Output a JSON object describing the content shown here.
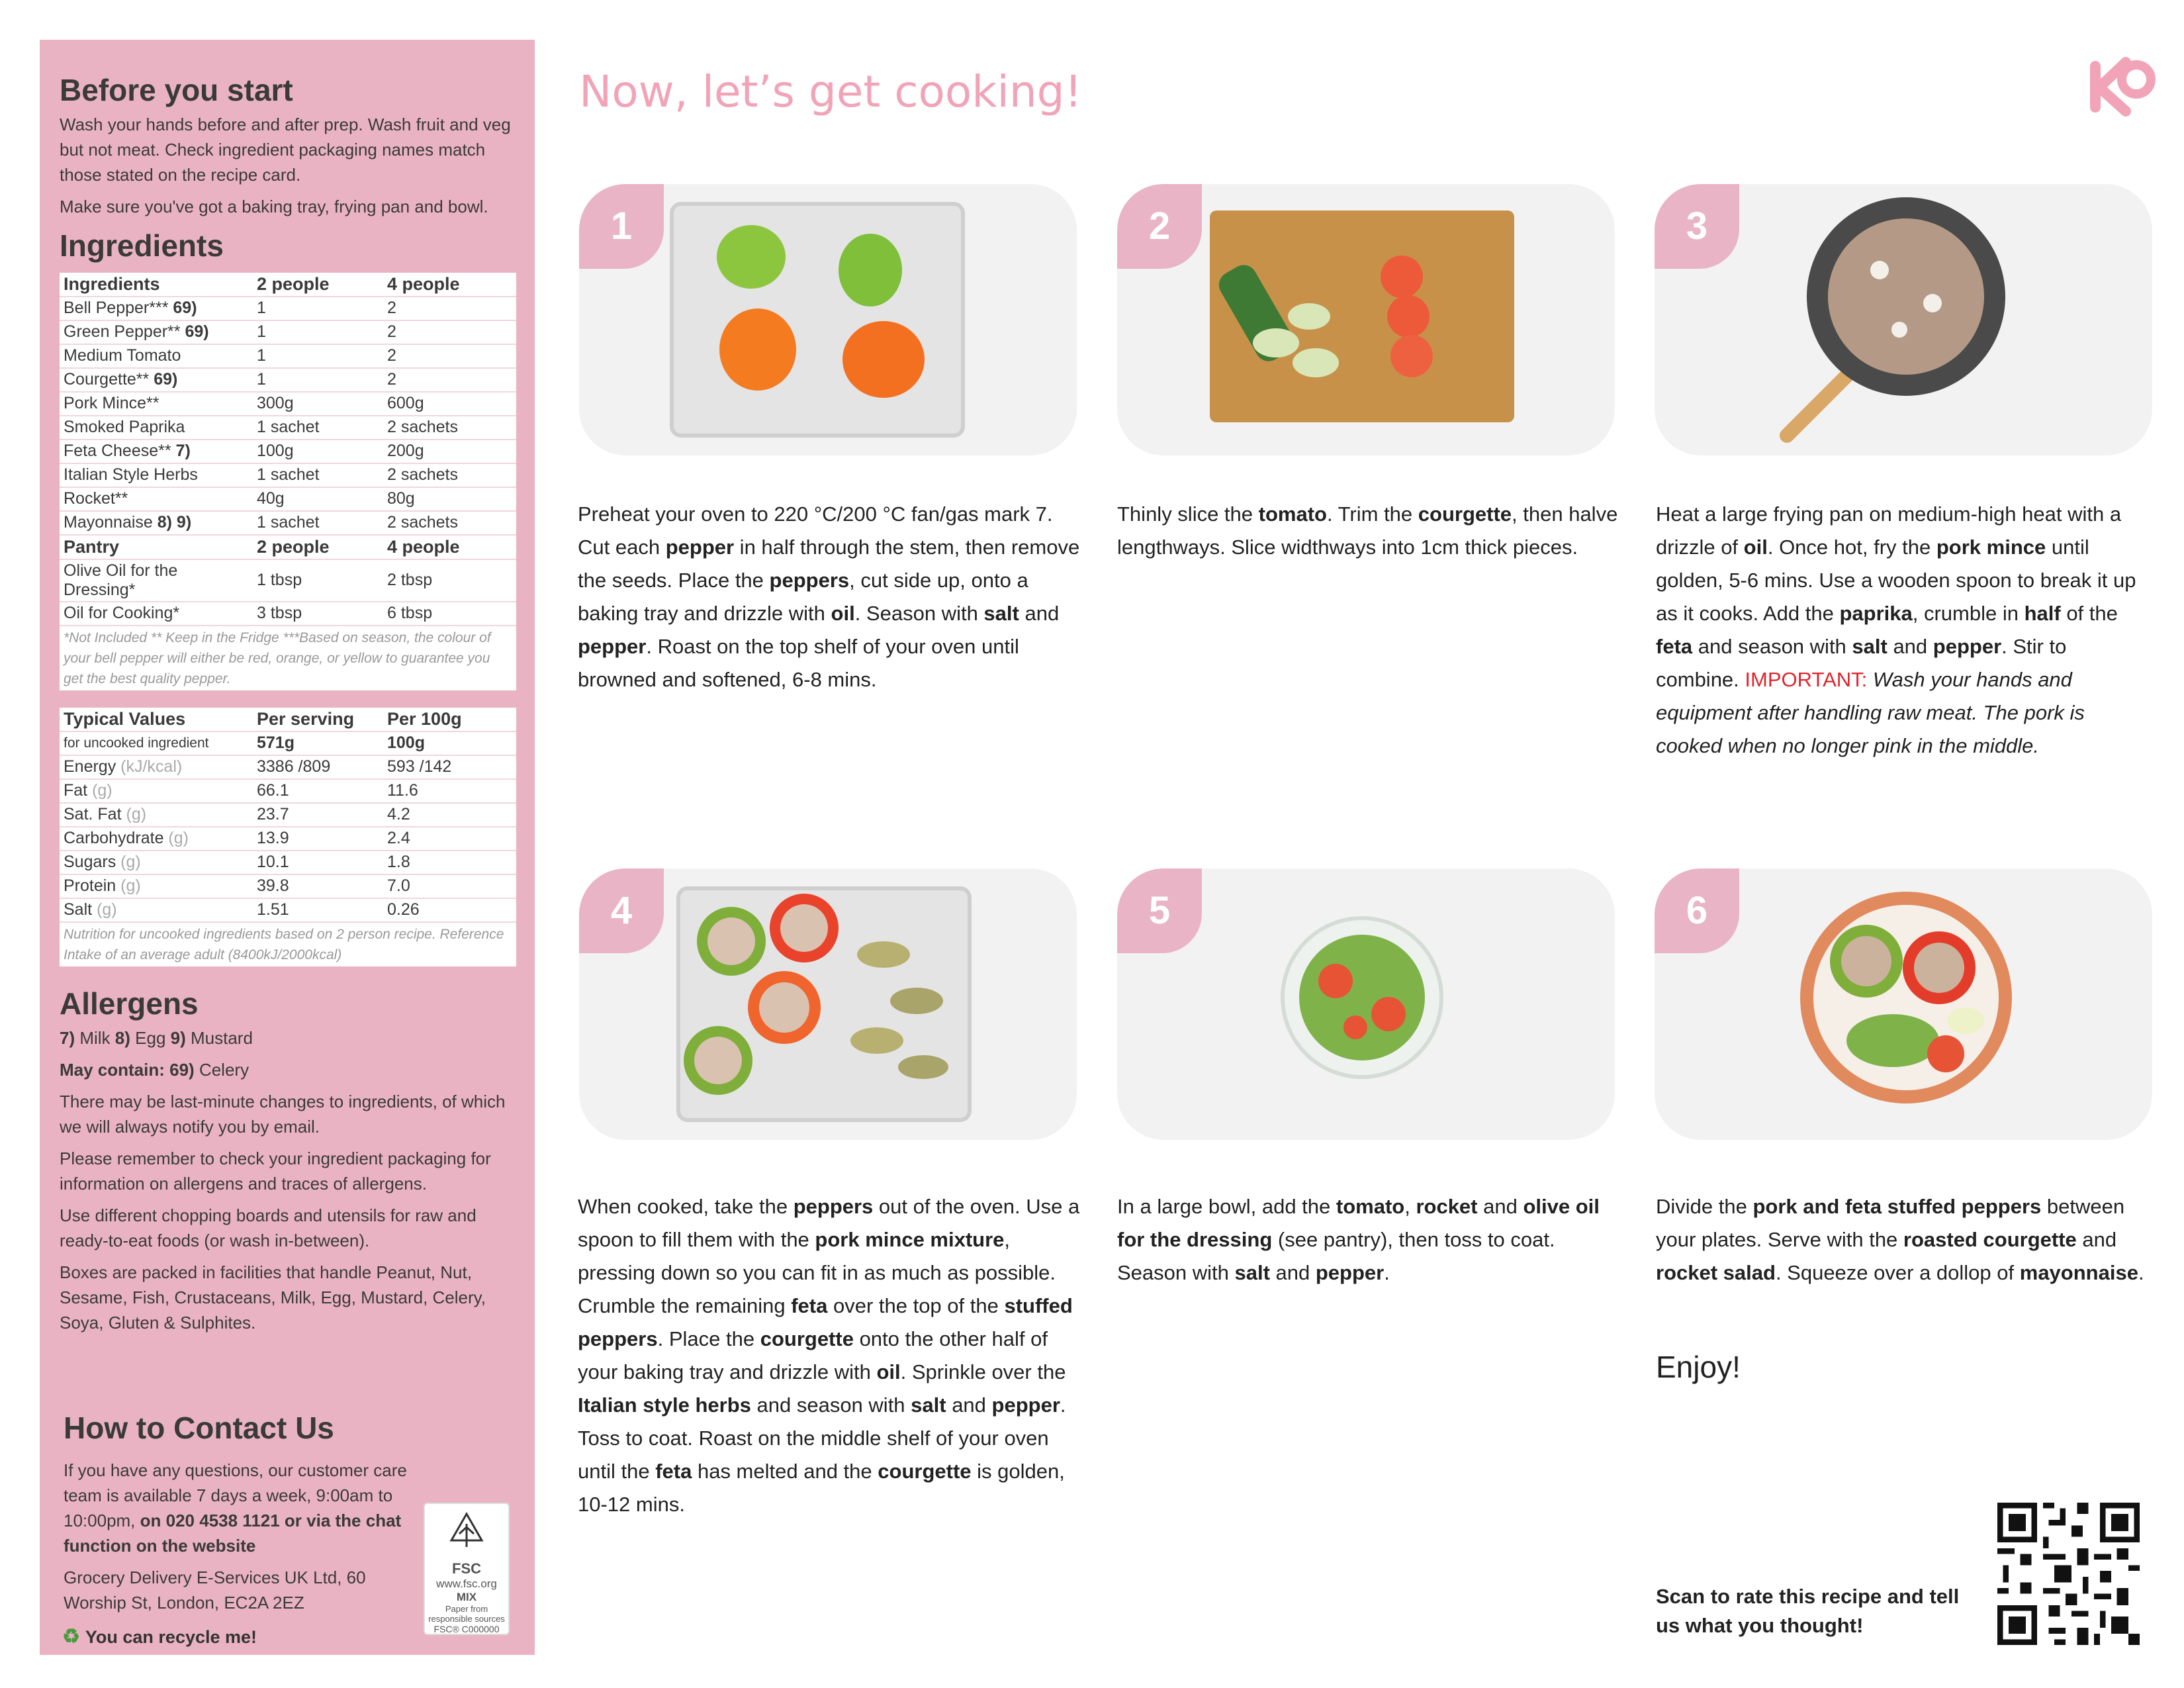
{
  "sidebar": {
    "before_title": "Before you start",
    "before_p1": "Wash your hands before and after prep. Wash fruit and veg but not meat. Check ingredient packaging names match those stated on the recipe card.",
    "before_p2": "Make sure you've got a baking tray, frying pan and bowl.",
    "ingredients_title": "Ingredients",
    "ingredients_header": [
      "Ingredients",
      "2 people",
      "4 people"
    ],
    "ingredients": [
      {
        "name": "Bell Pepper***",
        "code": " 69)",
        "p2": "1",
        "p4": "2"
      },
      {
        "name": "Green Pepper**",
        "code": " 69)",
        "p2": "1",
        "p4": "2"
      },
      {
        "name": "Medium Tomato",
        "code": "",
        "p2": "1",
        "p4": "2"
      },
      {
        "name": "Courgette**",
        "code": " 69)",
        "p2": "1",
        "p4": "2"
      },
      {
        "name": "Pork Mince**",
        "code": "",
        "p2": "300g",
        "p4": "600g"
      },
      {
        "name": "Smoked Paprika",
        "code": "",
        "p2": "1 sachet",
        "p4": "2 sachets"
      },
      {
        "name": "Feta Cheese**",
        "code": " 7)",
        "p2": "100g",
        "p4": "200g"
      },
      {
        "name": "Italian Style Herbs",
        "code": "",
        "p2": "1 sachet",
        "p4": "2 sachets"
      },
      {
        "name": "Rocket**",
        "code": "",
        "p2": "40g",
        "p4": "80g"
      },
      {
        "name": "Mayonnaise",
        "code": " 8) 9)",
        "p2": "1 sachet",
        "p4": "2 sachets"
      }
    ],
    "pantry_header": [
      "Pantry",
      "2 people",
      "4 people"
    ],
    "pantry": [
      {
        "name": "Olive Oil for the Dressing*",
        "p2": "1 tbsp",
        "p4": "2 tbsp"
      },
      {
        "name": "Oil for Cooking*",
        "p2": "3 tbsp",
        "p4": "6 tbsp"
      }
    ],
    "ingredients_note": "*Not Included  ** Keep in the Fridge ***Based on season, the colour of your bell pepper will either be red, orange, or yellow to guarantee you get the best quality pepper.",
    "nutrition_header": [
      "Typical Values",
      "Per serving",
      "Per 100g"
    ],
    "nutrition_sub": [
      "for uncooked ingredient",
      "571g",
      "100g"
    ],
    "nutrition": [
      {
        "name": "Energy",
        "unit": " (kJ/kcal)",
        "serving": "3386 /809",
        "per100": "593 /142"
      },
      {
        "name": "Fat",
        "unit": " (g)",
        "serving": "66.1",
        "per100": "11.6"
      },
      {
        "name": "Sat. Fat",
        "unit": " (g)",
        "serving": "23.7",
        "per100": "4.2"
      },
      {
        "name": "Carbohydrate",
        "unit": " (g)",
        "serving": "13.9",
        "per100": "2.4"
      },
      {
        "name": "Sugars",
        "unit": " (g)",
        "serving": "10.1",
        "per100": "1.8"
      },
      {
        "name": "Protein",
        "unit": " (g)",
        "serving": "39.8",
        "per100": "7.0"
      },
      {
        "name": "Salt",
        "unit": " (g)",
        "serving": "1.51",
        "per100": "0.26"
      }
    ],
    "nutrition_note": "Nutrition for uncooked ingredients based on 2 person recipe. Reference Intake of an average adult (8400kJ/2000kcal)",
    "allergens_title": "Allergens",
    "allergens_list": [
      {
        "code": "7)",
        "name": " Milk "
      },
      {
        "code": "8)",
        "name": " Egg "
      },
      {
        "code": "9)",
        "name": " Mustard"
      }
    ],
    "may_contain_label": "May contain: 69)",
    "may_contain_value": " Celery",
    "allergen_p1": "There may be last-minute changes to ingredients, of which we will always notify you by email.",
    "allergen_p2": "Please remember to check your ingredient packaging for information on allergens and traces of allergens.",
    "allergen_p3": "Use different chopping boards and utensils for raw and ready-to-eat foods (or wash in-between).",
    "allergen_p4": "Boxes are packed in facilities that handle Peanut, Nut, Sesame, Fish, Crustaceans, Milk, Egg, Mustard, Celery, Soya, Gluten & Sulphites.",
    "contact_title": "How to Contact Us",
    "contact_p1": "If you have any questions, our customer care team is available 7 days a week, 9:00am to 10:00pm, ",
    "contact_p1_bold": "on 020 4538 1121 or via the chat function on the website",
    "contact_p2": "Grocery Delivery E-Services UK Ltd, 60 Worship St, London, EC2A 2EZ",
    "recycle": "You can recycle me!",
    "fsc_label": "FSC",
    "fsc_site": "www.fsc.org",
    "fsc_mix": "MIX",
    "fsc_small1": "Paper from",
    "fsc_small2": "responsible sources",
    "fsc_code": "FSC® C000000"
  },
  "main": {
    "title": "Now, let’s get cooking!",
    "steps": [
      {
        "num": "1"
      },
      {
        "num": "2"
      },
      {
        "num": "3"
      },
      {
        "num": "4"
      },
      {
        "num": "5"
      },
      {
        "num": "6"
      }
    ],
    "enjoy": "Enjoy!",
    "scan": "Scan to rate this recipe and tell us what you thought!"
  },
  "colors": {
    "sidebar": "#eab3c4",
    "title": "#f1a4b8",
    "badge": "#e9b4c5",
    "important": "#e0252e"
  }
}
